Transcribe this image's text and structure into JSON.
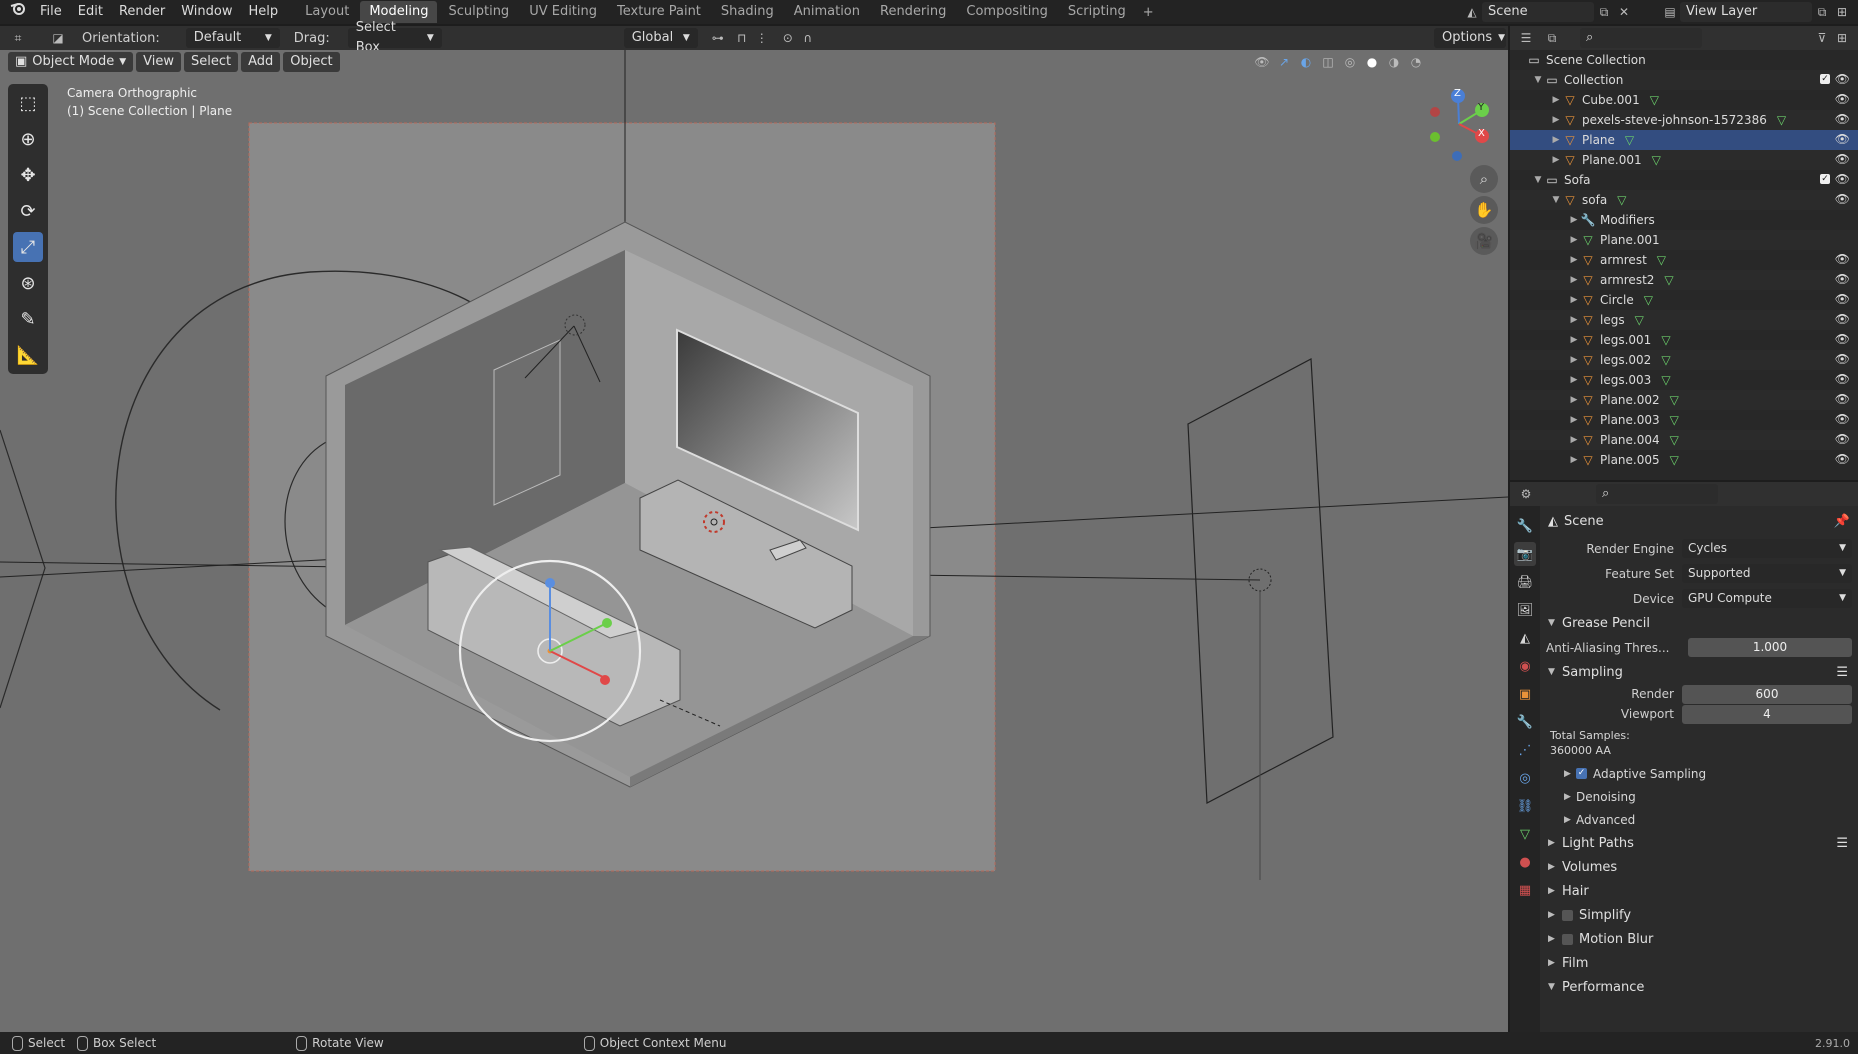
{
  "topbar": {
    "menus": [
      "File",
      "Edit",
      "Render",
      "Window",
      "Help"
    ],
    "workspaces": [
      "Layout",
      "Modeling",
      "Sculpting",
      "UV Editing",
      "Texture Paint",
      "Shading",
      "Animation",
      "Rendering",
      "Compositing",
      "Scripting"
    ],
    "active_workspace": "Modeling",
    "add_tab": "+",
    "scene": "Scene",
    "view_layer": "View Layer"
  },
  "tool_header": {
    "orientation_label": "Orientation:",
    "orientation_value": "Default",
    "drag_label": "Drag:",
    "drag_value": "Select Box",
    "transform_orientation": "Global",
    "options": "Options"
  },
  "viewport": {
    "mode": "Object Mode",
    "menus": [
      "View",
      "Select",
      "Add",
      "Object"
    ],
    "info_line1": "Camera Orthographic",
    "info_line2": "(1) Scene Collection | Plane",
    "axes": {
      "z": "Z",
      "y": "Y",
      "x": "X"
    }
  },
  "outliner": {
    "rows": [
      {
        "label": "Scene Collection",
        "indent": 0,
        "type": "scene",
        "arrow": ""
      },
      {
        "label": "Collection",
        "indent": 1,
        "type": "collection",
        "arrow": "▼",
        "checkbox": true
      },
      {
        "label": "Cube.001",
        "indent": 2,
        "type": "mesh",
        "arrow": "▶"
      },
      {
        "label": "pexels-steve-johnson-1572386",
        "indent": 2,
        "type": "mesh",
        "arrow": "▶"
      },
      {
        "label": "Plane",
        "indent": 2,
        "type": "mesh",
        "arrow": "▶",
        "selected": true
      },
      {
        "label": "Plane.001",
        "indent": 2,
        "type": "mesh",
        "arrow": "▶"
      },
      {
        "label": "Sofa",
        "indent": 1,
        "type": "collection",
        "arrow": "▼",
        "checkbox": true
      },
      {
        "label": "sofa",
        "indent": 2,
        "type": "mesh",
        "arrow": "▼"
      },
      {
        "label": "Modifiers",
        "indent": 3,
        "type": "modifier",
        "arrow": "▶"
      },
      {
        "label": "Plane.001",
        "indent": 3,
        "type": "meshdata",
        "arrow": "▶"
      },
      {
        "label": "armrest",
        "indent": 3,
        "type": "mesh",
        "arrow": "▶"
      },
      {
        "label": "armrest2",
        "indent": 3,
        "type": "mesh",
        "arrow": "▶"
      },
      {
        "label": "Circle",
        "indent": 3,
        "type": "mesh",
        "arrow": "▶"
      },
      {
        "label": "legs",
        "indent": 3,
        "type": "mesh",
        "arrow": "▶"
      },
      {
        "label": "legs.001",
        "indent": 3,
        "type": "mesh",
        "arrow": "▶"
      },
      {
        "label": "legs.002",
        "indent": 3,
        "type": "mesh",
        "arrow": "▶"
      },
      {
        "label": "legs.003",
        "indent": 3,
        "type": "mesh",
        "arrow": "▶"
      },
      {
        "label": "Plane.002",
        "indent": 3,
        "type": "mesh",
        "arrow": "▶"
      },
      {
        "label": "Plane.003",
        "indent": 3,
        "type": "mesh",
        "arrow": "▶"
      },
      {
        "label": "Plane.004",
        "indent": 3,
        "type": "mesh",
        "arrow": "▶"
      },
      {
        "label": "Plane.005",
        "indent": 3,
        "type": "mesh",
        "arrow": "▶"
      }
    ]
  },
  "properties": {
    "context": "Scene",
    "render_engine_label": "Render Engine",
    "render_engine": "Cycles",
    "feature_set_label": "Feature Set",
    "feature_set": "Supported",
    "device_label": "Device",
    "device": "GPU Compute",
    "grease_pencil": "Grease Pencil",
    "aa_label": "Anti-Aliasing Thres...",
    "aa_value": "1.000",
    "sampling": "Sampling",
    "render_label": "Render",
    "render_value": "600",
    "viewport_label": "Viewport",
    "viewport_value": "4",
    "total_samples_label": "Total Samples:",
    "total_samples_value": "360000 AA",
    "adaptive_sampling": "Adaptive Sampling",
    "denoising": "Denoising",
    "advanced": "Advanced",
    "sections": [
      "Light Paths",
      "Volumes",
      "Hair",
      "Simplify",
      "Motion Blur",
      "Film",
      "Performance"
    ]
  },
  "statusbar": {
    "select": "Select",
    "box_select": "Box Select",
    "rotate_view": "Rotate View",
    "context_menu": "Object Context Menu",
    "version": "2.91.0"
  }
}
